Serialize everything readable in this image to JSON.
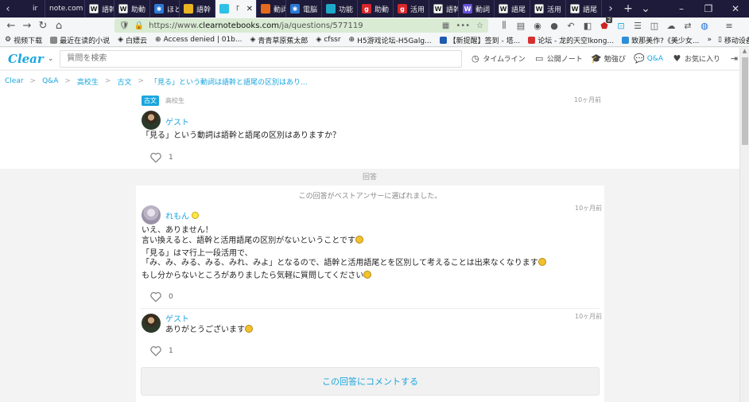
{
  "browser": {
    "tabs": [
      {
        "label": "ir",
        "icon": "",
        "active": false
      },
      {
        "label": "note.com",
        "icon": "",
        "active": false
      },
      {
        "label": "語幹",
        "icon": "W",
        "active": false
      },
      {
        "label": "助動",
        "icon": "W",
        "active": false
      },
      {
        "label": "ほと",
        "icon": "",
        "active": false
      },
      {
        "label": "語幹",
        "icon": "",
        "active": false
      },
      {
        "label": "「",
        "icon": "",
        "active": true
      },
      {
        "label": "動詞",
        "icon": "",
        "active": false
      },
      {
        "label": "電脳",
        "icon": "",
        "active": false
      },
      {
        "label": "功能",
        "icon": "",
        "active": false
      },
      {
        "label": "助動",
        "icon": "",
        "active": false
      },
      {
        "label": "活用",
        "icon": "",
        "active": false
      },
      {
        "label": "語幹",
        "icon": "W",
        "active": false
      },
      {
        "label": "動詞",
        "icon": "",
        "active": false
      },
      {
        "label": "語尾",
        "icon": "W",
        "active": false
      },
      {
        "label": "活用",
        "icon": "W",
        "active": false
      },
      {
        "label": "語尾",
        "icon": "W",
        "active": false
      }
    ],
    "url": {
      "prefix": "https://www.",
      "host": "clearnotebooks.com",
      "path": "/ja/questions/577119"
    },
    "badge_count": "2",
    "bookmarks": [
      "视频下载",
      "最近在读的小说",
      "白嫖云",
      "Access denied | 01b...",
      "青青草原蕉太郎",
      "cfssr",
      "H5游戏论坛-H5Galg...",
      "【新提醒】签到 - 塔...",
      "论坛 - 龙的天空lkong...",
      "致那美作?《美少女...",
      "移动设备上的书签"
    ]
  },
  "site": {
    "logo": "Clear",
    "search_placeholder": "質問を検索",
    "nav": [
      {
        "label": "タイムライン",
        "icon": "clock-icon"
      },
      {
        "label": "公開ノート",
        "icon": "notebook-icon"
      },
      {
        "label": "勉強ぴ",
        "icon": "graduation-cap-icon"
      },
      {
        "label": "Q&A",
        "icon": "chat-icon"
      },
      {
        "label": "お気に入り",
        "icon": "heart-icon"
      }
    ],
    "breadcrumb": [
      "Clear",
      "Q&A",
      "高校生",
      "古文",
      "「見る」という動詞は語幹と語尾の区別はあり..."
    ]
  },
  "question": {
    "tag": "古文",
    "grade": "高校生",
    "time": "10ヶ月前",
    "user": "ゲスト",
    "text": "「見る」という動詞は語幹と語尾の区別はありますか？",
    "likes": "1"
  },
  "answers_label": "回答",
  "answer": {
    "best_note": "この回答がベストアンサーに選ばれました。",
    "user": "れもん",
    "time": "10ヶ月前",
    "lines": [
      "いえ、ありません！",
      "言い換えると、語幹と活用語尾の区別がないということです",
      "「見る」はマ行上一段活用で、",
      "「み、み、みる、みる、みれ、みよ」となるので、語幹と活用語尾とを区別して考えることは出来なくなります",
      "もし分からないところがありましたら気軽に質問してください"
    ],
    "likes": "0"
  },
  "comment": {
    "user": "ゲスト",
    "time": "10ヶ月前",
    "text": "ありがとうございます",
    "likes": "1"
  },
  "comment_button": "この回答にコメントする",
  "colors": {
    "accent": "#1aa6de",
    "tabbar": "#1e1a3a",
    "urlbar": "#d9ebd3"
  }
}
